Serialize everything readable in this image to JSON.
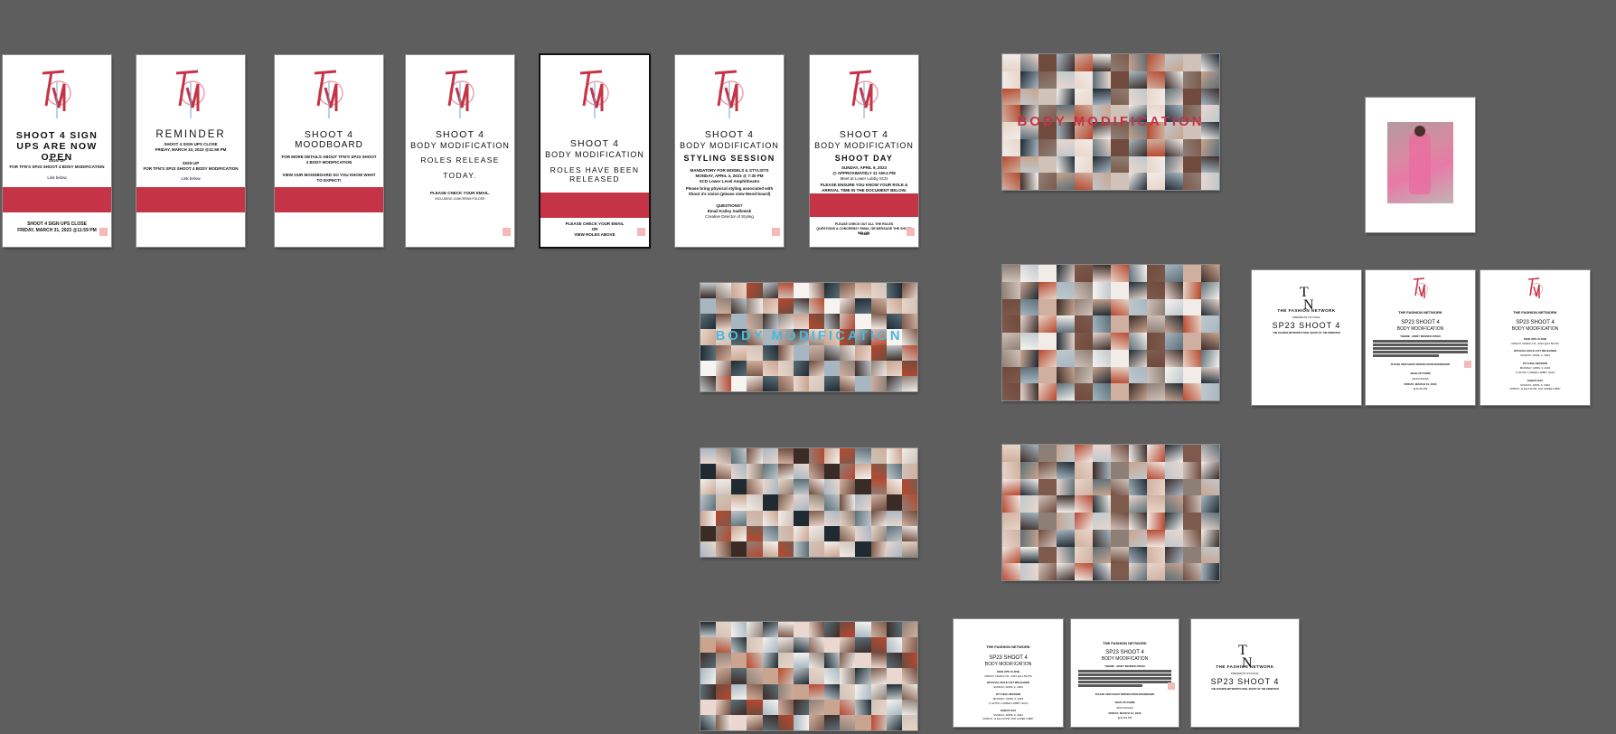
{
  "story_cards": [
    {
      "title": "SHOOT 4 SIGN UPS ARE NOW OPEN",
      "small_1": "SIGN UP",
      "small_2": "FOR TFN'S SP23 SHOOT 4 BODY MODIFICATION",
      "small_3": "Link below",
      "footer_1": "SHOOT 4 SIGN UPS CLOSE",
      "footer_2": "FRIDAY, MARCH 31, 2023 @11:59 PM"
    },
    {
      "title": "REMINDER",
      "small_1": "SHOOT 4 SIGN UPS CLOSE",
      "small_2": "FRIDAY, MARCH 10, 2023 @11:59 PM",
      "small_3": "SIGN UP",
      "small_4": "FOR TFN'S SP23 SHOOT 4 BODY MODIFICATION",
      "small_5": "Link below"
    },
    {
      "title": "SHOOT 4",
      "sub": "MOODBOARD",
      "small_1": "FOR MORE DETAILS ABOUT TFN'S SP23 SHOOT 4 BODY MODIFICATION",
      "small_2": "VIEW OUR MOODBOARD SO YOU KNOW WHAT TO EXPECT!"
    },
    {
      "title": "SHOOT 4",
      "sub": "BODY MODIFICATION",
      "mid_1": "ROLES RELEASE",
      "mid_2": "TODAY.",
      "small_1": "PLEASE CHECK YOUR EMAIL.",
      "small_2": "INCLUDING JUNK/SPAM FOLDER"
    },
    {
      "title": "SHOOT 4",
      "sub": "BODY MODIFICATION",
      "mid_1": "ROLES HAVE BEEN",
      "mid_2": "RELEASED",
      "small_1": "PLEASE CHECK YOUR EMAIL",
      "small_2": "OR",
      "small_3": "VIEW ROLES ABOVE"
    },
    {
      "title": "SHOOT 4",
      "sub": "BODY MODIFICATION",
      "mid_1": "STYLING SESSION",
      "small_1": "MANDATORY FOR MODELS & STYLISTS",
      "small_2": "MONDAY, APRIL 3, 2023 @ 7:30 PM",
      "small_3": "SCD Lower Level Amphitheatre",
      "small_4": "Please bring physical styling associated with Shoot 4's vision (please view Mood-board)",
      "small_5": "QUESTIONS?",
      "small_6": "Email Kailey Sadlowsk",
      "small_7": "Creative Director of Styling"
    },
    {
      "title": "SHOOT 4",
      "sub": "BODY MODIFICATION",
      "mid_1": "SHOOT DAY",
      "small_1": "SUNDAY, APRIL 9, 2023",
      "small_2": "@ APPROXIMATELY 11 AM-4 PM",
      "small_3": "Meet at Lower Lobby SCD",
      "small_4": "PLEASE ENSURE YOU KNOW YOUR ROLE & ARRIVAL TIME IN THE DOCUMENT BELOW.",
      "small_5": "PLEASE CHECK OUT ALL THE ROLES",
      "small_6": "QUESTIONS & CONCERNS? EMAIL OR MESSAGE THE SHOOT TEAM",
      "small_7": "BELOW."
    }
  ],
  "collage_cards": [
    {
      "overlay": "BODY MODIFICATION",
      "overlay_color": "#c53446"
    },
    {
      "overlay": "BODY MODIFICATION",
      "overlay_color": "#4fb6d8"
    },
    {
      "overlay": ""
    },
    {
      "overlay": ""
    },
    {
      "overlay": ""
    },
    {
      "overlay": ""
    }
  ],
  "doc_cards": {
    "network": "THE FASHION NETWORK",
    "presents": "PRESENTS ITS FINAL",
    "shoot_title": "SP23 SHOOT 4",
    "sub": "BODY MODIFICATION",
    "tagline": "THE FASHION NETWORK'S FINAL SHOOT OF THE SEMESTER",
    "theme": "THEME : BODY MODIFICATION",
    "signups": "SIGN UPS CLOSE",
    "signups_date": "FRIDAY, MARCH 31, 2023 @11:59 PM",
    "roles": "OFFICIAL ROLE LIST RELEASED",
    "roles_date": "SUNDAY, APRIL 2, 2023",
    "styling": "STYLING SESSION",
    "styling_date": "MONDAY, APRIL 3, 2023",
    "styling_time": "(7:30 PM, LOWER LOBBY SCD)",
    "shoot_day": "SHOOT DAY",
    "shoot_day_date": "SUNDAY, APRIL 9, 2023",
    "shoot_day_time": "APPROX. 11 AM-4:00 PM, SCD LOWER LOBBY",
    "moodboard": "PLEASE VIEW SHOOT MODIFICATION MOODBOARD",
    "form": "SIGN UP FORM",
    "roles_link": "SP23 ROLES",
    "form_date": "FRIDAY, MARCH 31, 2023",
    "form_time": "@11:59 PM"
  },
  "colors": {
    "accent": "#c53446",
    "canvas": "#5e5e5e",
    "pink_corner": "#f4b9b9",
    "cyan": "#4fb6d8"
  },
  "icons": {
    "logo": "tfn-logo-icon",
    "corner": "corner-swatch-icon"
  }
}
